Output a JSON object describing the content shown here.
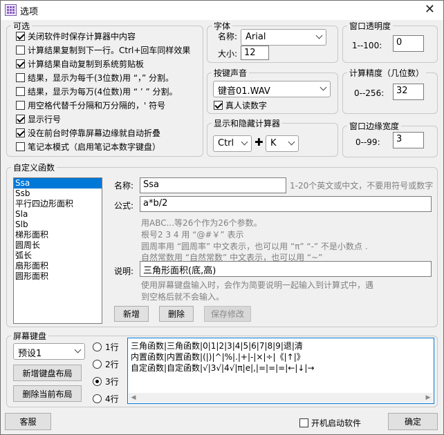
{
  "window": {
    "title": "选项",
    "close_glyph": "✕"
  },
  "optional": {
    "legend": "可选",
    "items": [
      {
        "label": "关闭软件时保存计算器中内容",
        "checked": true
      },
      {
        "label": "计算结果复制到下一行。Ctrl+回车同样效果",
        "checked": false
      },
      {
        "label": "计算结果自动复制到系统剪贴板",
        "checked": true
      },
      {
        "label": "结果，显示为每千(3位数)用 “，” 分割。",
        "checked": false
      },
      {
        "label": "结果，显示为每万(4位数)用 “ ’ ” 分割。",
        "checked": false
      },
      {
        "label": "用空格代替千分隔和万分隔的，' 符号",
        "checked": false
      },
      {
        "label": "显示行号",
        "checked": true
      },
      {
        "label": "没在前台时停靠屏幕边缘就自动折叠",
        "checked": true
      },
      {
        "label": "笔记本模式（启用笔记本数字键盘）",
        "checked": false
      }
    ]
  },
  "font": {
    "legend": "字体",
    "name_label": "名称:",
    "name_value": "Arial",
    "size_label": "大小:",
    "size_value": "12"
  },
  "sound": {
    "legend": "按键声音",
    "value": "键音01.WAV",
    "voice_label": "真人读数字",
    "voice_checked": true
  },
  "hotkey": {
    "legend": "显示和隐藏计算器",
    "modifier": "Ctrl",
    "plus": "✚",
    "key": "K"
  },
  "opacity": {
    "legend": "窗口透明度",
    "range_label": "1--100:",
    "value": "0"
  },
  "precision": {
    "legend": "计算精度（几位数）",
    "range_label": "0--256:",
    "value": "32"
  },
  "border": {
    "legend": "窗口边缘宽度",
    "range_label": "0--99:",
    "value": "3"
  },
  "custom": {
    "legend": "自定义函数",
    "list": [
      "Ssa",
      "Ssb",
      "平行四边形面积",
      "Sla",
      "Slb",
      "梯形面积",
      "圆周长",
      "弧长",
      "扇形面积",
      "圆形面积"
    ],
    "name_label": "名称:",
    "name_value": "Ssa",
    "name_hint": "1-20个英文或中文，不要用符号或数字",
    "formula_label": "公式:",
    "formula_value": "a*b/2",
    "help": [
      "用ABC...等26个作为26个参数。",
      "根号2 3 4 用 “@#￥” 表示",
      "圆周率用 “圆周率” 中文表示，也可以用 “π”  “-” 不是小数点 .",
      "自然常数用 “自然常数” 中文表示，也可以用 “~”"
    ],
    "desc_label": "说明:",
    "desc_value": "三角形面积(底,高)",
    "desc_help": [
      "使用屏幕键盘输入时，会作为简要说明一起输入到计算式中，遇",
      "到空格后就不会输入。"
    ],
    "btn_new": "新增",
    "btn_delete": "删除",
    "btn_save": "保存修改"
  },
  "keyboard": {
    "legend": "屏幕键盘",
    "preset": "预设1",
    "btn_new_layout": "新增键盘布局",
    "btn_delete_layout": "删除当前布局",
    "rows": [
      {
        "label": "1行",
        "checked": false
      },
      {
        "label": "2行",
        "checked": false
      },
      {
        "label": "3行",
        "checked": true
      },
      {
        "label": "4行",
        "checked": false
      }
    ],
    "lines": [
      "三角函数|三角函数|0|1|2|3|4|5|6|7|8|9|退|清",
      "内置函数|内置函数|(|)|^|%|.|+|-|×|÷|《|↑|》",
      "自定函数|自定函数|√|3√|4√|π|e|,|=|=|=|←|↓|→"
    ]
  },
  "footer": {
    "btn_support": "客服",
    "autostart_label": "开机启动软件",
    "autostart_checked": false,
    "btn_ok": "确定"
  }
}
